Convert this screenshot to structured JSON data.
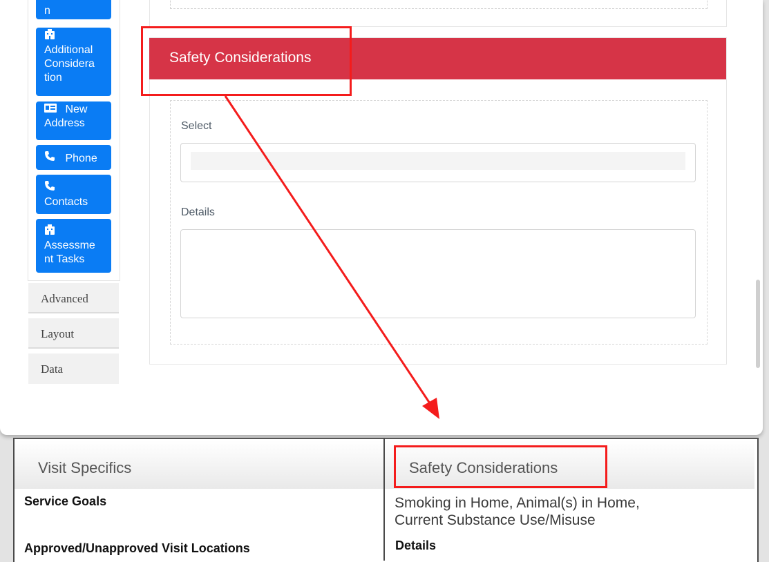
{
  "sidebar": {
    "components": [
      {
        "label": "n",
        "icon": ""
      },
      {
        "label": "Additional Consideration",
        "icon": "building-icon"
      },
      {
        "label": "New Address",
        "icon": "address-card-icon"
      },
      {
        "label": "Phone",
        "icon": "phone-icon"
      },
      {
        "label": "Contacts",
        "icon": "phone-icon"
      },
      {
        "label": "Assessment Tasks",
        "icon": "building-icon"
      }
    ],
    "component_lines": {
      "c0": [
        "n"
      ],
      "c1": [
        "Additional",
        "Considera",
        "tion"
      ],
      "c2": [
        "New",
        "Address"
      ],
      "c3": [
        "Phone"
      ],
      "c4": [
        "Contacts"
      ],
      "c5": [
        "Assessme",
        "nt Tasks"
      ]
    },
    "tabs": [
      "Advanced",
      "Layout",
      "Data"
    ]
  },
  "editor": {
    "panel_title": "Safety Considerations",
    "select_label": "Select",
    "select_value": "",
    "details_label": "Details",
    "details_value": ""
  },
  "preview": {
    "left_section_title": "Visit Specifics",
    "service_goals_label": "Service Goals",
    "visit_locations_label": "Approved/Unapproved Visit Locations",
    "right_section_title": "Safety Considerations",
    "safety_value_line1": "Smoking in Home, Animal(s) in Home,",
    "safety_value_line2": "Current Substance Use/Misuse",
    "details_label": "Details"
  },
  "colors": {
    "component_button": "#0a7cf4",
    "panel_header": "#d63447",
    "annotation": "#f41c1c"
  }
}
